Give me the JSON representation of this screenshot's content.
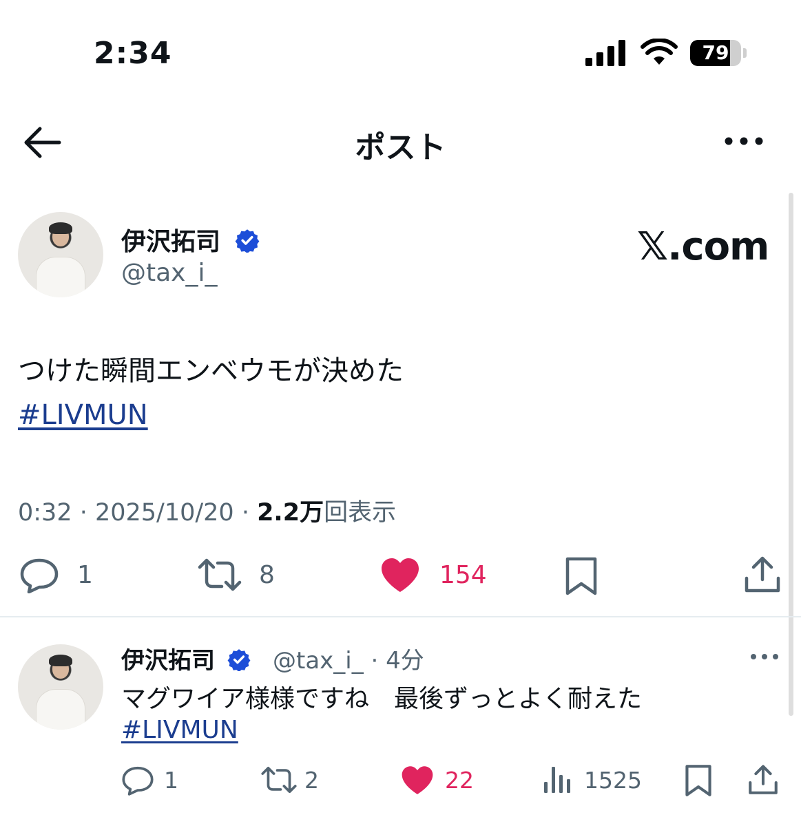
{
  "status_bar": {
    "time": "2:34",
    "battery": "79",
    "battery_level": 0.79
  },
  "header": {
    "title": "ポスト",
    "back_icon": "arrow-left-icon",
    "more_icon": "more-horizontal-icon"
  },
  "post": {
    "author_name": "伊沢拓司",
    "author_handle": "@tax_i_",
    "watermark": "𝕏.com",
    "text": "つけた瞬間エンベウモが決めた",
    "hashtag": "#LIVMUN",
    "meta_time": "0:32 · 2025/10/20 · ",
    "meta_views_value": "2.2万",
    "meta_views_label": "回表示",
    "actions": {
      "reply_count": "1",
      "repost_count": "8",
      "like_count": "154"
    }
  },
  "reply": {
    "author_name": "伊沢拓司",
    "author_handle_time": "@tax_i_ · 4分",
    "text": "マグワイア様様ですね　最後ずっとよく耐えた",
    "hashtag": "#LIVMUN",
    "actions": {
      "reply_count": "1",
      "repost_count": "2",
      "like_count": "22",
      "views_count": "1525"
    }
  },
  "colors": {
    "accent_blue": "#1b3d8f",
    "verified": "#1d4ed8",
    "like": "#e0245e",
    "muted": "#536471"
  }
}
